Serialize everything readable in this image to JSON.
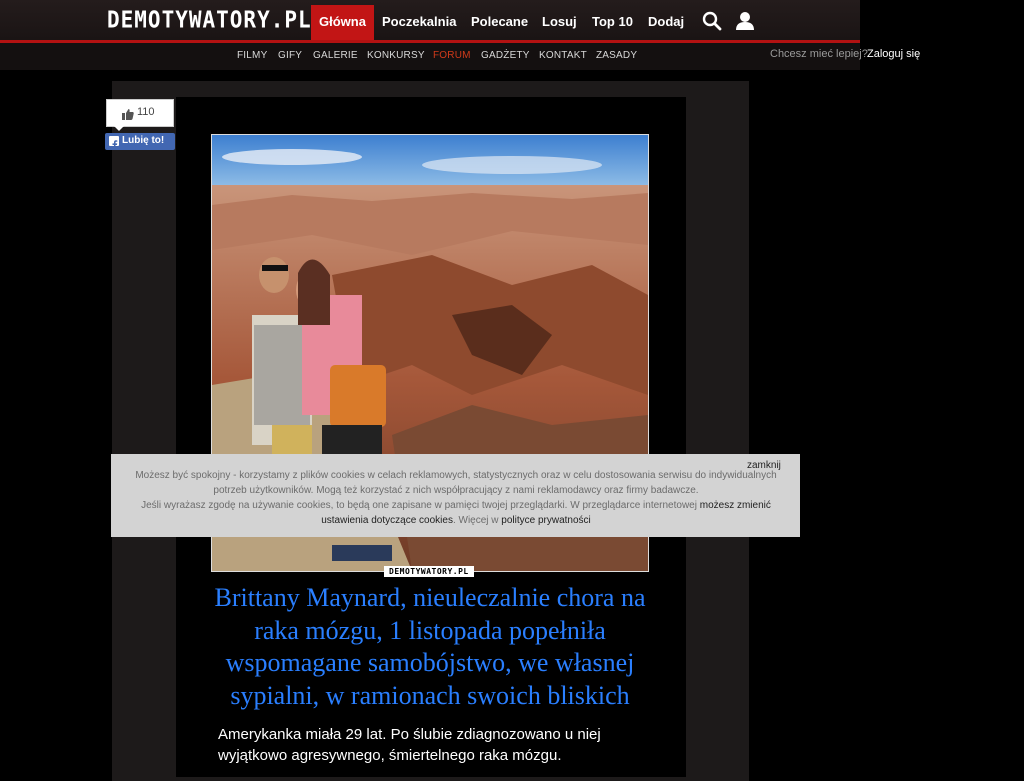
{
  "header": {
    "logo": "DEMOTYWATORY.PL",
    "nav": [
      {
        "label": "Główna"
      },
      {
        "label": "Poczekalnia"
      },
      {
        "label": "Polecane"
      },
      {
        "label": "Losuj"
      },
      {
        "label": "Top 10"
      },
      {
        "label": "Dodaj"
      }
    ],
    "icons": [
      "search-icon",
      "user-icon"
    ]
  },
  "subnav": {
    "items": [
      {
        "label": "FILMY"
      },
      {
        "label": "GIFY"
      },
      {
        "label": "GALERIE"
      },
      {
        "label": "KONKURSY"
      },
      {
        "label": "FORUM"
      },
      {
        "label": "GADŻETY"
      },
      {
        "label": "KONTAKT"
      },
      {
        "label": "ZASADY"
      }
    ],
    "login_prompt": "Chcesz mieć lepiej?",
    "login_link": "Zaloguj się"
  },
  "post": {
    "likes": "110",
    "fb_like_label": "Lubię to!",
    "watermark": "DEMOTYWATORY.PL",
    "headline": "Brittany Maynard, nieuleczalnie chora na raka mózgu, 1 listopada popełniła wspomagane samobójstwo, we własnej sypialni, w ramionach swoich bliskich",
    "body": "Amerykanka miała 29 lat. Po ślubie zdiagnozowano u niej wyjątkowo agresywnego, śmiertelnego raka mózgu."
  },
  "cookie": {
    "text1": "Możesz być spokojny - korzystamy z plików cookies w celach reklamowych, statystycznych oraz w celu dostosowania serwisu do indywidualnych potrzeb użytkowników. Mogą też korzystać z nich współpracujący z nami reklamodawcy oraz firmy badawcze.",
    "text2": "Jeśli wyrażasz zgodę na używanie cookies, to będą one zapisane w pamięci twojej przeglądarki. W przeglądarce internetowej",
    "link1": "możesz zmienić ustawienia dotyczące cookies",
    "text3": ". Więcej w",
    "link2": "polityce prywatności",
    "close": "zamknij"
  },
  "colors": {
    "accent": "#c21515",
    "headline": "#2a7fff",
    "facebook": "#4267b2"
  }
}
